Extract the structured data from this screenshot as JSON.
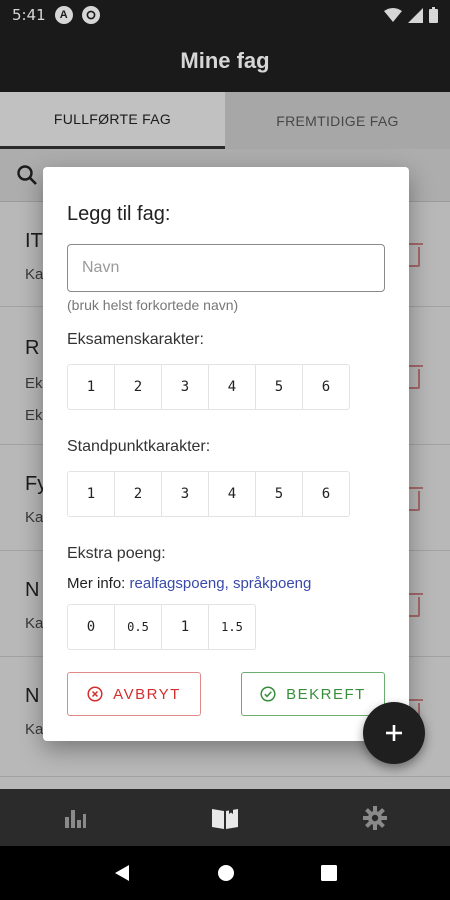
{
  "status_bar": {
    "time": "5:41",
    "icon_a": "A"
  },
  "app_bar": {
    "title": "Mine fag"
  },
  "tabs": [
    {
      "label": "FULLFØRTE FAG",
      "active": true
    },
    {
      "label": "FREMTIDIGE FAG",
      "active": false
    }
  ],
  "background_list": [
    {
      "title": "IT",
      "lines": [
        "Ka"
      ]
    },
    {
      "title": "R",
      "lines": [
        "Ek",
        "Ek"
      ]
    },
    {
      "title": "Fy",
      "lines": [
        "Ka"
      ]
    },
    {
      "title": "N",
      "lines": [
        "Ka"
      ]
    },
    {
      "title": "N",
      "lines": [
        "Ka"
      ]
    }
  ],
  "dialog": {
    "title": "Legg til fag:",
    "name_placeholder": "Navn",
    "name_value": "",
    "helper": "(bruk helst forkortede navn)",
    "exam_label": "Eksamenskarakter:",
    "exam_grades": [
      "1",
      "2",
      "3",
      "4",
      "5",
      "6"
    ],
    "standpoint_label": "Standpunktkarakter:",
    "standpoint_grades": [
      "1",
      "2",
      "3",
      "4",
      "5",
      "6"
    ],
    "extra_label": "Ekstra poeng:",
    "info_prefix": "Mer info: ",
    "info_link_1": "realfagspoeng",
    "info_sep": ", ",
    "info_link_2": "språkpoeng",
    "extra_points": [
      "0",
      "0.5",
      "1",
      "1.5"
    ],
    "cancel_label": "AVBRYT",
    "confirm_label": "BEKREFT"
  },
  "colors": {
    "app_bar": "#1f1f1f",
    "cancel": "#d32f2f",
    "confirm": "#388e3c",
    "link": "#3949ab"
  },
  "icons": {
    "search": "search-icon",
    "fab": "plus-icon",
    "nav": [
      "bar-chart-icon",
      "book-icon",
      "gear-icon"
    ],
    "system": [
      "back-icon",
      "home-icon",
      "recents-icon"
    ]
  }
}
